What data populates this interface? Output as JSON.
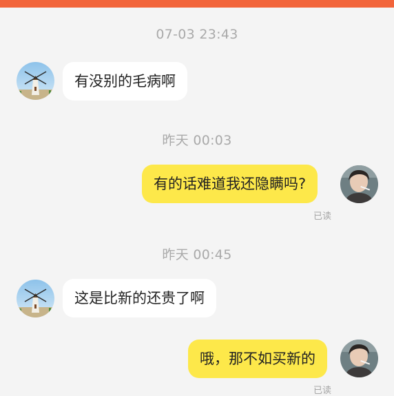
{
  "colors": {
    "top_bar": "#f2643a",
    "background": "#f4f4f4",
    "incoming_bubble": "#ffffff",
    "outgoing_bubble": "#fde84a",
    "timestamp_text": "#a9a9a9"
  },
  "messages": [
    {
      "timestamp": "07-03 23:43",
      "direction": "incoming",
      "text": "有没别的毛病啊",
      "avatar": "windmill-avatar"
    },
    {
      "timestamp": "昨天 00:03",
      "direction": "outgoing",
      "text": "有的话难道我还隐瞒吗?",
      "status": "已读",
      "avatar": "person-avatar"
    },
    {
      "timestamp": "昨天 00:45",
      "direction": "incoming",
      "text": "这是比新的还贵了啊",
      "avatar": "windmill-avatar"
    },
    {
      "direction": "outgoing",
      "text": "哦，那不如买新的",
      "status": "已读",
      "avatar": "person-avatar"
    }
  ]
}
